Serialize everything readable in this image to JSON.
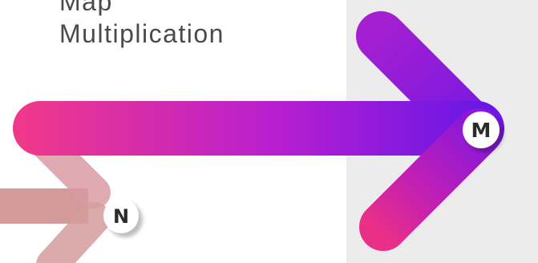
{
  "title": {
    "line1": "Map",
    "line2": "Multiplication"
  },
  "nodes": {
    "source": "N",
    "target": "M"
  },
  "colors": {
    "arrow_start": "#f0388a",
    "arrow_mid": "#b81fcf",
    "arrow_end": "#6a16e6",
    "faded_arrow": "#c87a7a",
    "panel": "#ececec",
    "title_text": "#4a4a4a"
  }
}
